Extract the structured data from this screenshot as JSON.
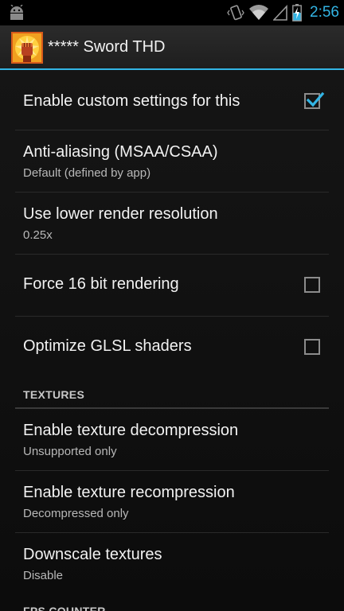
{
  "status_bar": {
    "time": "2:56",
    "icons": [
      "android-debug-icon",
      "vibrate-icon",
      "wifi-icon",
      "signal-icon",
      "battery-charging-icon"
    ],
    "accent_color": "#33b5e5"
  },
  "action_bar": {
    "title": "***** Sword THD",
    "app_icon": "app-icon-fist"
  },
  "settings": {
    "enable_custom": {
      "title": "Enable custom settings for this",
      "checked": true
    },
    "anti_aliasing": {
      "title": "Anti-aliasing (MSAA/CSAA)",
      "summary": "Default (defined by app)"
    },
    "lower_resolution": {
      "title": "Use lower render resolution",
      "summary": "0.25x"
    },
    "force_16bit": {
      "title": "Force 16 bit rendering",
      "checked": false
    },
    "optimize_glsl": {
      "title": "Optimize GLSL shaders",
      "checked": false
    }
  },
  "textures": {
    "header": "TEXTURES",
    "decompression": {
      "title": "Enable texture decompression",
      "summary": "Unsupported only"
    },
    "recompression": {
      "title": "Enable texture recompression",
      "summary": "Decompressed only"
    },
    "downscale": {
      "title": "Downscale textures",
      "summary": "Disable"
    }
  },
  "fps_counter": {
    "header": "FPS COUNTER"
  }
}
